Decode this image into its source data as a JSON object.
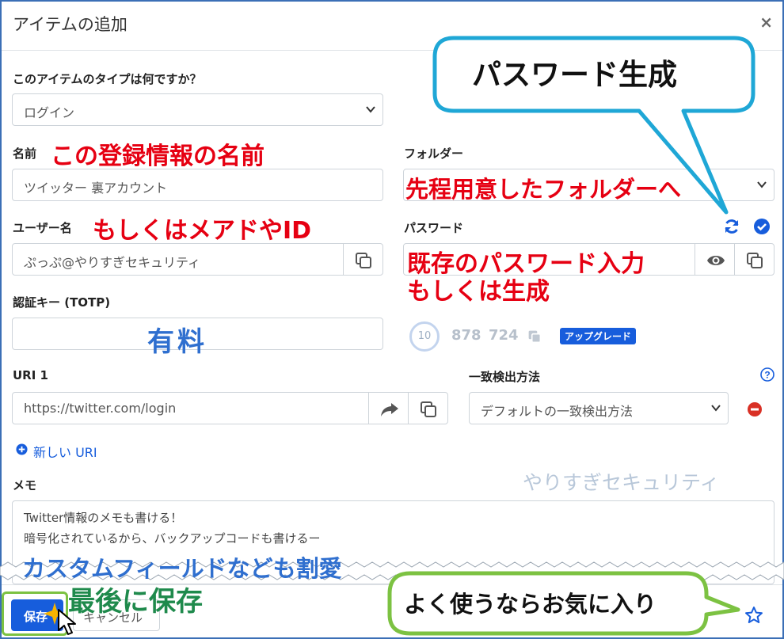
{
  "dialog": {
    "title": "アイテムの追加",
    "close_glyph": "×"
  },
  "type_field": {
    "label": "このアイテムのタイプは何ですか？",
    "value": "ログイン"
  },
  "name_field": {
    "label": "名前",
    "value": "ツイッター 裏アカウント"
  },
  "folder_field": {
    "label": "フォルダー"
  },
  "username_field": {
    "label": "ユーザー名",
    "value": "ぷっぷ@やりすぎセキュリティ"
  },
  "password_field": {
    "label": "パスワード"
  },
  "totp_field": {
    "label": "認証キー (TOTP)",
    "countdown": "10",
    "code_part1": "878",
    "code_part2": "724",
    "upgrade_badge": "アップグレード"
  },
  "uri_field": {
    "label": "URI 1",
    "value": "https://twitter.com/login"
  },
  "match_field": {
    "label": "一致検出方法",
    "value": "デフォルトの一致検出方法"
  },
  "new_uri": {
    "label": "新しい URI"
  },
  "notes": {
    "label": "メモ",
    "line1": "Twitter情報のメモも書ける！",
    "line2": "暗号化されているから、バックアップコードも書けるー"
  },
  "footer": {
    "save_label": "保存",
    "cancel_label": "キャンセル"
  },
  "annotations": {
    "name_note": "この登録情報の名前",
    "folder_note": "先程用意したフォルダーへ",
    "username_note": "もしくはメアドやID",
    "password_note_1": "既存のパスワード入力",
    "password_note_2": "もしくは生成",
    "totp_note": "有料",
    "generate_bubble": "パスワード生成",
    "custom_fields_note": "カスタムフィールドなども割愛",
    "save_note": "最後に保存",
    "favorite_bubble": "よく使うならお気に入り",
    "watermark": "やりすぎセキュリティ"
  },
  "colors": {
    "brand_blue": "#175ddc",
    "annotation_red": "#e60012",
    "annotation_blue": "#2f6fcf",
    "annotation_green": "#1f8a4c",
    "bubble_cyan": "#1fa7d6",
    "bubble_green": "#7cc242",
    "remove_red": "#d93025"
  }
}
